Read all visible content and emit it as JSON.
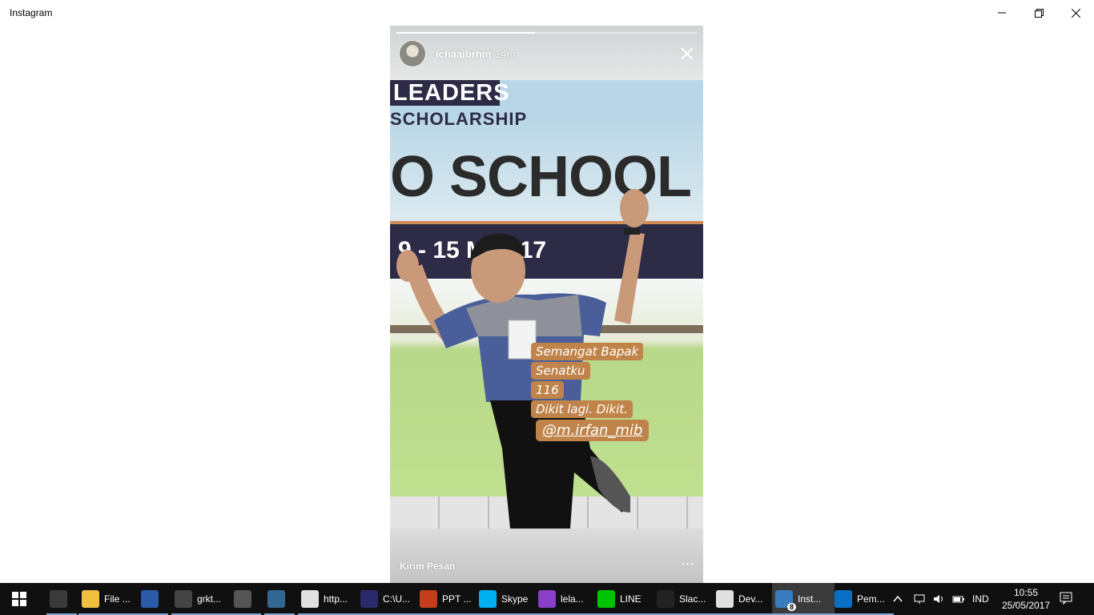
{
  "window": {
    "title": "Instagram"
  },
  "story": {
    "progress": 0.46,
    "username": "ichaaibrhm",
    "time_ago": "14m",
    "photo": {
      "banner_leaders": "LEADERS",
      "banner_scholarship": "SCHOLARSHIP",
      "banner_headline": "O SCHOOL",
      "banner_dates": "9 - 15 M  2017"
    },
    "caption_lines": [
      "Semangat Bapak",
      "Senatku",
      "116",
      "Dikit lagi. Dikit."
    ],
    "mention": "@m.irfan_mib",
    "footer": {
      "send_message": "Kirim Pesan",
      "more": "···"
    }
  },
  "taskbar": {
    "items": [
      {
        "label": "",
        "icon": "hs-icon",
        "color": "#3a3a3a"
      },
      {
        "label": "File ...",
        "icon": "folder-icon",
        "color": "#f0c040"
      },
      {
        "label": "",
        "icon": "dev-icon",
        "color": "#2a5aa8"
      },
      {
        "label": "grkt...",
        "icon": "git-icon",
        "color": "#444"
      },
      {
        "label": "",
        "icon": "sublime-icon",
        "color": "#555"
      },
      {
        "label": "",
        "icon": "postgres-icon",
        "color": "#336791"
      },
      {
        "label": "http...",
        "icon": "chrome-icon",
        "color": "#e0e0e0"
      },
      {
        "label": "C:\\U...",
        "icon": "terminal-icon",
        "color": "#2a2a6a"
      },
      {
        "label": "PPT ...",
        "icon": "powerpoint-icon",
        "color": "#c43e1c"
      },
      {
        "label": "Skype",
        "icon": "skype-icon",
        "color": "#00aff0"
      },
      {
        "label": "lela...",
        "icon": "phpstorm-icon",
        "color": "#8a3fc8"
      },
      {
        "label": "LINE",
        "icon": "line-icon",
        "color": "#00c300"
      },
      {
        "label": "Slac...",
        "icon": "slack-icon",
        "color": "#222"
      },
      {
        "label": "Dev...",
        "icon": "chrome-icon",
        "color": "#e0e0e0"
      },
      {
        "label": "Inst...",
        "icon": "instagram-icon",
        "color": "#3b7bbf",
        "badge": "8"
      },
      {
        "label": "Pem...",
        "icon": "edge-icon",
        "color": "#0b6ec5"
      }
    ],
    "language": "IND",
    "clock_time": "10:55",
    "clock_date": "25/05/2017"
  }
}
